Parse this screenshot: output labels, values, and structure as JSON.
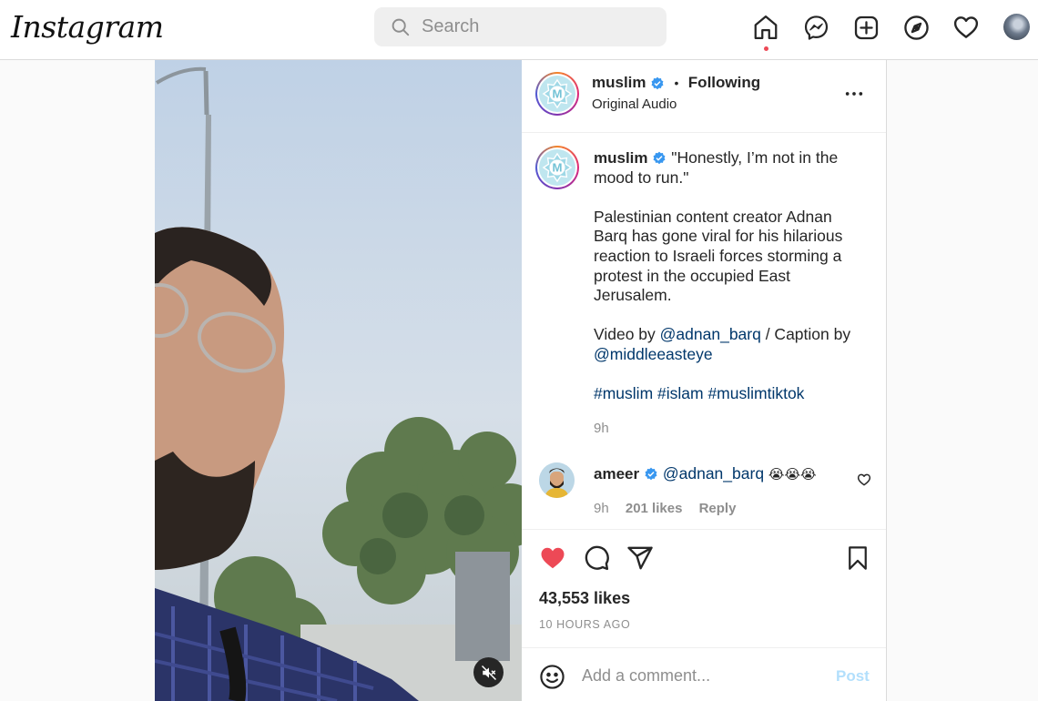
{
  "app": {
    "logo_text": "Instagram"
  },
  "search": {
    "placeholder": "Search"
  },
  "nav": {
    "icons": [
      "home-icon",
      "messenger-icon",
      "new-post-icon",
      "explore-icon",
      "activity-heart-icon",
      "profile-avatar"
    ],
    "notification_color": "#ed4956"
  },
  "post": {
    "author": "muslim",
    "separator": "•",
    "follow_status": "Following",
    "audio": "Original Audio",
    "caption": {
      "author": "muslim",
      "line1": "\"Honestly, I’m not in the mood to run.\"",
      "line2": "Palestinian content creator Adnan Barq has gone viral for his hilarious reaction to Israeli forces storming a protest in the occupied East Jerusalem.",
      "line3_prefix": "Video by ",
      "line3_link1": "@adnan_barq",
      "line3_mid": " / Caption by ",
      "line3_link2": "@middleeasteye",
      "hashtags": "#muslim #islam #muslimtiktok"
    },
    "caption_time": "9h",
    "comment": {
      "author": "ameer",
      "mention": "@adnan_barq",
      "emojis": "😭😭😭",
      "time": "9h",
      "likes": "201 likes",
      "reply": "Reply"
    },
    "likes": "43,553 likes",
    "posted": "10 HOURS AGO",
    "add_comment_placeholder": "Add a comment...",
    "post_button": "Post",
    "liked": true,
    "like_color": "#ed4956",
    "link_color": "#00376b",
    "verified_color": "#3897f0"
  }
}
